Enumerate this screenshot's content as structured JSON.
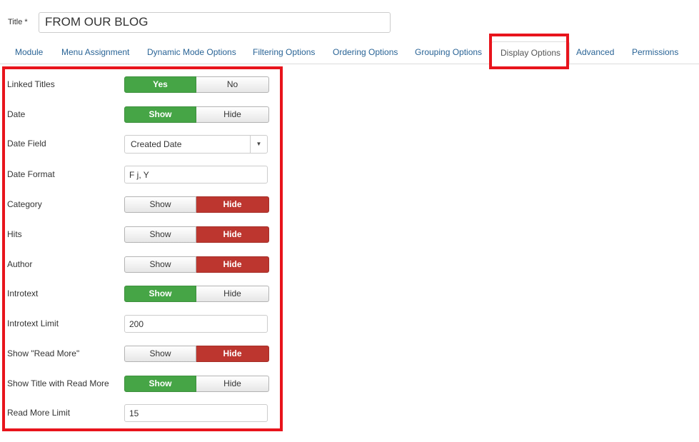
{
  "title": {
    "label": "Title *",
    "value": "FROM OUR BLOG"
  },
  "tabs": [
    {
      "label": "Module"
    },
    {
      "label": "Menu Assignment"
    },
    {
      "label": "Dynamic Mode Options"
    },
    {
      "label": "Filtering Options"
    },
    {
      "label": "Ordering Options"
    },
    {
      "label": "Grouping Options"
    },
    {
      "label": "Display Options",
      "active": true
    },
    {
      "label": "Advanced"
    },
    {
      "label": "Permissions"
    }
  ],
  "options": {
    "linked_titles": {
      "label": "Linked Titles",
      "on": "Yes",
      "off": "No",
      "selected": "Yes"
    },
    "date": {
      "label": "Date",
      "on": "Show",
      "off": "Hide",
      "selected": "Show"
    },
    "date_field": {
      "label": "Date Field",
      "value": "Created Date"
    },
    "date_format": {
      "label": "Date Format",
      "value": "F j, Y"
    },
    "category": {
      "label": "Category",
      "on": "Show",
      "off": "Hide",
      "selected": "Hide"
    },
    "hits": {
      "label": "Hits",
      "on": "Show",
      "off": "Hide",
      "selected": "Hide"
    },
    "author": {
      "label": "Author",
      "on": "Show",
      "off": "Hide",
      "selected": "Hide"
    },
    "introtext": {
      "label": "Introtext",
      "on": "Show",
      "off": "Hide",
      "selected": "Show"
    },
    "introtext_limit": {
      "label": "Introtext Limit",
      "value": "200"
    },
    "show_read_more": {
      "label": "Show \"Read More\"",
      "on": "Show",
      "off": "Hide",
      "selected": "Hide"
    },
    "show_title_read_more": {
      "label": "Show Title with Read More",
      "on": "Show",
      "off": "Hide",
      "selected": "Show"
    },
    "read_more_limit": {
      "label": "Read More Limit",
      "value": "15"
    }
  },
  "colors": {
    "green": "#46a546",
    "red": "#bd362f",
    "highlight": "#e8141c",
    "link": "#2a6496"
  }
}
